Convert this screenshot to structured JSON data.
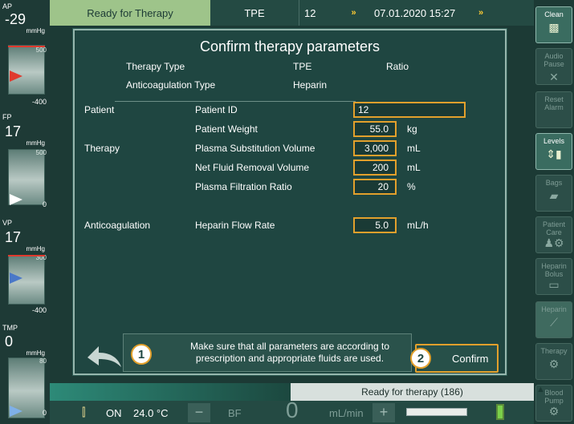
{
  "pressures": [
    {
      "label": "AP",
      "value": "-29",
      "unit": "mmHg",
      "scale_top": "500",
      "scale_bottom": "-400"
    },
    {
      "label": "FP",
      "value": "17",
      "unit": "mmHg",
      "scale_top": "500",
      "scale_bottom": "0"
    },
    {
      "label": "VP",
      "value": "17",
      "unit": "mmHg",
      "scale_top": "300",
      "scale_bottom": "-400"
    },
    {
      "label": "TMP",
      "value": "0",
      "unit": "mmHg",
      "scale_top": "80",
      "scale_bottom": "0"
    }
  ],
  "topbar": {
    "status": "Ready for Therapy",
    "mode": "TPE",
    "patient_no": "12",
    "datetime": "07.01.2020 15:27",
    "arrow": "»"
  },
  "sidebar": [
    {
      "label": "Clean",
      "icon": "clean-icon",
      "active": true
    },
    {
      "label": "Audio Pause",
      "icon": "audio-pause-icon",
      "active": false
    },
    {
      "label": "Reset Alarm",
      "icon": "reset-alarm-icon",
      "active": false
    },
    {
      "label": "Levels",
      "icon": "levels-icon",
      "active": true
    },
    {
      "label": "Bags",
      "icon": "bags-icon",
      "active": false
    },
    {
      "label": "Patient Care",
      "icon": "patient-care-icon",
      "active": false
    },
    {
      "label": "Heparin Bolus",
      "icon": "heparin-bolus-icon",
      "active": false
    },
    {
      "label": "Heparin",
      "icon": "heparin-icon",
      "active": false
    },
    {
      "label": "Therapy",
      "icon": "therapy-icon",
      "active": false
    },
    {
      "label": "Blood Pump",
      "icon": "blood-pump-icon",
      "active": false
    }
  ],
  "dialog": {
    "title": "Confirm therapy parameters",
    "therapy_type_label": "Therapy Type",
    "therapy_type_value": "TPE",
    "therapy_type_extra": "Ratio",
    "anticoag_type_label": "Anticoagulation Type",
    "anticoag_type_value": "Heparin",
    "sections": {
      "patient": "Patient",
      "therapy": "Therapy",
      "anticoag": "Anticoagulation"
    },
    "fields": {
      "patient_id": {
        "label": "Patient ID",
        "value": "12",
        "unit": ""
      },
      "patient_weight": {
        "label": "Patient Weight",
        "value": "55.0",
        "unit": "kg"
      },
      "plasma_sub": {
        "label": "Plasma Substitution Volume",
        "value": "3,000",
        "unit": "mL"
      },
      "net_fluid": {
        "label": "Net Fluid Removal Volume",
        "value": "200",
        "unit": "mL"
      },
      "plasma_ratio": {
        "label": "Plasma Filtration Ratio",
        "value": "20",
        "unit": "%"
      },
      "heparin_rate": {
        "label": "Heparin Flow Rate",
        "value": "5.0",
        "unit": "mL/h"
      }
    },
    "note": "Make sure that all parameters are according to prescription and appropriate fluids are used.",
    "step1": "1",
    "step2": "2",
    "confirm_label": "Confirm"
  },
  "statusbar": {
    "message": "Ready for therapy (186)"
  },
  "bottombar": {
    "on_label": "ON",
    "temperature": "24.0 °C",
    "bf_label": "BF",
    "bf_value": "0",
    "bf_unit": "mL/min",
    "minus": "−",
    "plus": "+"
  },
  "colors": {
    "background": "#1c3a35",
    "accent_orange": "#e2a02c",
    "status_green": "#9ec48a",
    "alarm_red": "#e03a2e"
  }
}
